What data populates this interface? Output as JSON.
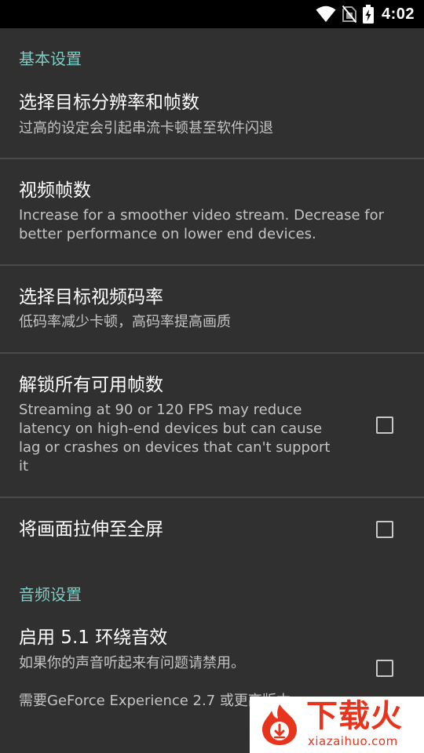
{
  "status_bar": {
    "time": "4:02",
    "icons": [
      "wifi-icon",
      "no-sim-icon",
      "battery-charging-icon"
    ]
  },
  "sections": {
    "basic": {
      "title": "基本设置",
      "resolution": {
        "title": "选择目标分辨率和帧数",
        "summary": "过高的设定会引起串流卡顿甚至软件闪退"
      },
      "fps": {
        "title": "视频帧数",
        "summary_line1": "Increase for a smoother video stream. Decrease for",
        "summary_line2": "better performance on lower end devices."
      },
      "bitrate": {
        "title": "选择目标视频码率",
        "summary": "低码率减少卡顿，高码率提高画质"
      },
      "unlock_fps": {
        "title": "解锁所有可用帧数",
        "summary_line1": "Streaming at 90 or 120 FPS may reduce",
        "summary_line2": "latency on high-end devices but can cause",
        "summary_line3": "lag or crashes on devices that can't support",
        "summary_line4": "it",
        "checked": false
      },
      "stretch": {
        "title": "将画面拉伸至全屏",
        "checked": false
      }
    },
    "audio": {
      "title": "音频设置",
      "surround": {
        "title": "启用 5.1 环绕音效",
        "summary_line1": "如果你的声音听起来有问题请禁用。",
        "summary_line2": "需要GeForce Experience 2.7 或更高版本",
        "checked": false
      }
    }
  },
  "watermark": {
    "title": "下载火",
    "subtitle": "xiazaihuo.com"
  },
  "colors": {
    "background": "#303030",
    "status_bar": "#000000",
    "category_accent": "#80cbc4",
    "divider": "#4a4a4a",
    "watermark_red": "#e8341c"
  }
}
